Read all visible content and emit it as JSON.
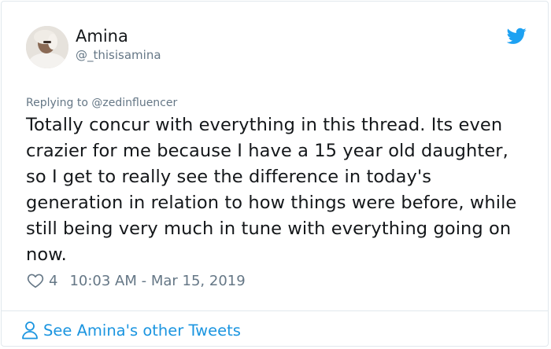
{
  "tweet": {
    "author_name": "Amina",
    "author_handle": "@_thisisamina",
    "replying_prefix": "Replying to ",
    "replying_to": "@zedinfluencer",
    "text": "Totally concur with everything in this thread. Its even crazier for me because I have a 15 year old daughter, so I get to really see the difference in today's generation in relation to how things were before, while still being very much in tune with everything going on now.",
    "likes": "4",
    "timestamp": "10:03 AM - Mar 15, 2019"
  },
  "footer": {
    "link_label": "See Amina's other Tweets"
  },
  "icons": {
    "brand": "twitter-bird-icon",
    "like": "heart-icon",
    "profile": "person-icon",
    "accent_color": "#1da1f2",
    "link_color": "#1b95e0"
  }
}
